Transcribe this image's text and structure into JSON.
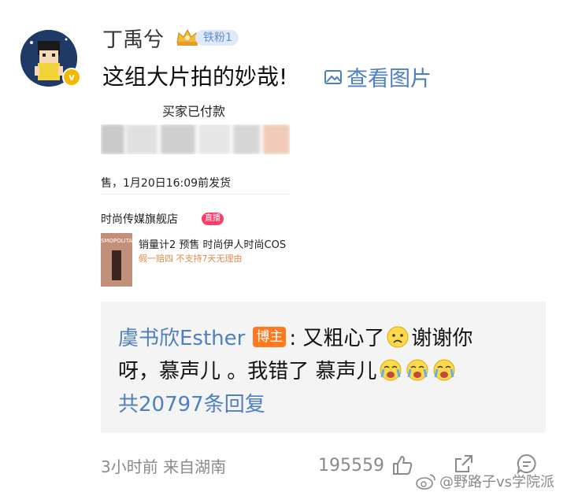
{
  "post": {
    "username": "丁禹兮",
    "fan_badge": "铁粉1",
    "comment_text": "这组大片拍的妙哉!",
    "view_image_label": "查看图片"
  },
  "attachment": {
    "title": "买家已付款",
    "shipping": "售，1月20日16:09前发货",
    "shop": "时尚传媒旗舰店",
    "live_tag": "直播",
    "magazine": "SMOPOLITAN",
    "sales": "销量计2 预售 时尚伊人时尚COS",
    "guarantee": "假一赔四 不支持7天无理由"
  },
  "reply": {
    "author": "虞书欣Esther",
    "author_tag": "博主",
    "text_line1": ": 又粗心了",
    "text_line1_tail": " 谢谢你",
    "text_line2": "呀，慕声儿 。我错了 慕声儿",
    "count": "共20797条回复"
  },
  "footer": {
    "time_location": "3小时前  来自湖南",
    "likes": "195559",
    "watermark": "@野路子vs学院派"
  },
  "colors": {
    "link_blue": "#4d7fc1",
    "blogger_orange": "#ff7a1f",
    "reply_bg": "#f4f4f4",
    "meta_gray": "#8a8a8a"
  }
}
